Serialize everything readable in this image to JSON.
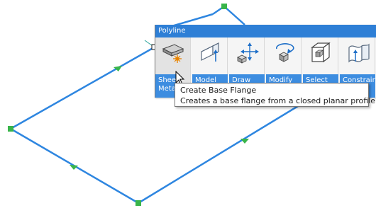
{
  "toolbar": {
    "title": "Polyline",
    "tools": [
      {
        "label": "Sheet Metal",
        "icon": "sheet-metal-flange-icon"
      },
      {
        "label": "Model",
        "icon": "model-extrude-icon"
      },
      {
        "label": "Draw",
        "icon": "draw-move-icon"
      },
      {
        "label": "Modify",
        "icon": "modify-rotate-icon"
      },
      {
        "label": "Select",
        "icon": "select-box-icon"
      },
      {
        "label": "Constrain",
        "icon": "constrain-surface-icon"
      }
    ]
  },
  "tooltip": {
    "title": "Create Base Flange",
    "description": "Creates a base flange from a closed planar profile"
  },
  "colors": {
    "profile_line": "#2e86e0",
    "vertex": "#39b54a",
    "panel_header": "#2e7fd6",
    "tool_label_bg": "#3d8de0"
  }
}
